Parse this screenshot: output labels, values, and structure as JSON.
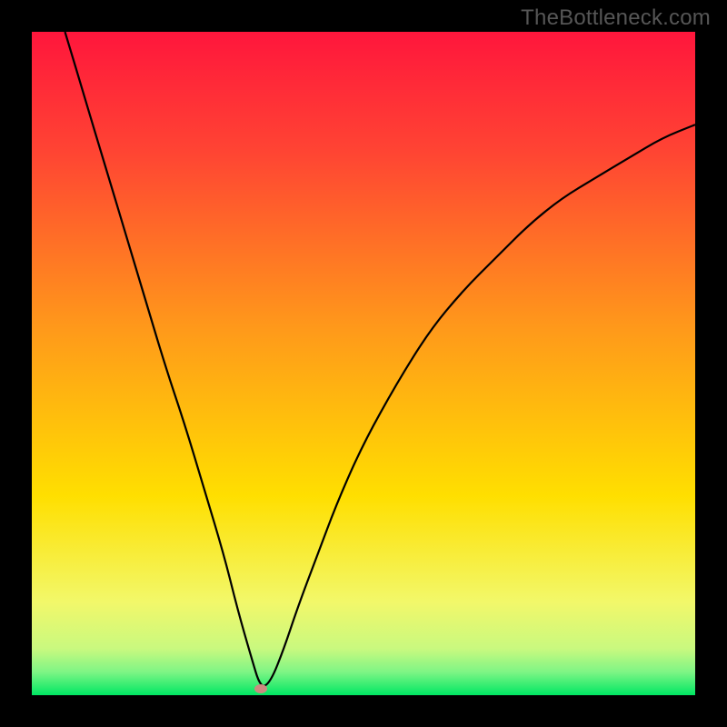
{
  "watermark": "TheBottleneck.com",
  "colors": {
    "frame": "#000000",
    "gradient_top": "#ff163c",
    "gradient_mid": "#ffdf00",
    "gradient_bottom": "#00e763",
    "curve": "#000000",
    "marker": "#cd8a80"
  },
  "chart_data": {
    "type": "line",
    "title": "",
    "xlabel": "",
    "ylabel": "",
    "xlim": [
      0,
      100
    ],
    "ylim": [
      0,
      100
    ],
    "grid": false,
    "series": [
      {
        "name": "bottleneck-curve",
        "x": [
          5,
          8,
          11,
          14,
          17,
          20,
          23,
          26,
          29,
          31,
          33,
          34.5,
          36,
          38,
          40,
          43,
          46,
          50,
          55,
          60,
          65,
          70,
          75,
          80,
          85,
          90,
          95,
          100
        ],
        "values": [
          100,
          90,
          80,
          70,
          60,
          50,
          41,
          31,
          21,
          13,
          6,
          1,
          2,
          7,
          13,
          21,
          29,
          38,
          47,
          55,
          61,
          66,
          71,
          75,
          78,
          81,
          84,
          86
        ]
      }
    ],
    "marker": {
      "x": 34.5,
      "y": 1
    },
    "gradient_stops": [
      {
        "offset": 0.0,
        "color": "#ff163c"
      },
      {
        "offset": 0.18,
        "color": "#ff4433"
      },
      {
        "offset": 0.45,
        "color": "#ff9a1a"
      },
      {
        "offset": 0.7,
        "color": "#ffdf00"
      },
      {
        "offset": 0.86,
        "color": "#f2f86a"
      },
      {
        "offset": 0.93,
        "color": "#c9f97f"
      },
      {
        "offset": 0.965,
        "color": "#7ef585"
      },
      {
        "offset": 1.0,
        "color": "#00e763"
      }
    ]
  }
}
